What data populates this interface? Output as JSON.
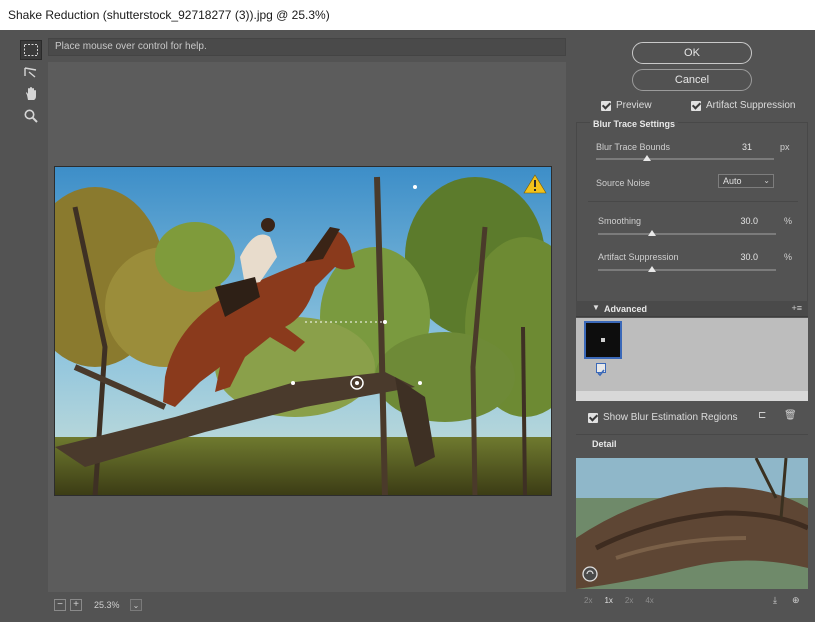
{
  "window": {
    "title": "Shake Reduction (shutterstock_92718277 (3)).jpg @ 25.3%)"
  },
  "tools": [
    {
      "name": "blur-estimation-tool-icon"
    },
    {
      "name": "blur-direction-tool-icon"
    },
    {
      "name": "hand-tool-icon"
    },
    {
      "name": "zoom-tool-icon"
    }
  ],
  "help": {
    "text": "Place mouse over control for help."
  },
  "canvas": {
    "zoom": "25.3%",
    "warning_icon": "warning-icon"
  },
  "buttons": {
    "ok": "OK",
    "cancel": "Cancel"
  },
  "options": {
    "preview": "Preview",
    "artifact_suppression": "Artifact Suppression"
  },
  "blur_trace": {
    "title": "Blur Trace Settings",
    "bounds_label": "Blur Trace Bounds",
    "bounds_value": "31",
    "bounds_unit": "px",
    "noise_label": "Source Noise",
    "noise_value": "Auto",
    "smoothing_label": "Smoothing",
    "smoothing_value": "30.0",
    "smoothing_unit": "%",
    "artifact_label": "Artifact Suppression",
    "artifact_value": "30.0",
    "artifact_unit": "%"
  },
  "advanced": {
    "title": "Advanced",
    "show_regions": "Show Blur Estimation Regions"
  },
  "detail": {
    "title": "Detail",
    "zoom_levels": [
      "2x",
      "1x",
      "2x",
      "4x"
    ],
    "selected_zoom_index": 1
  },
  "colors": {
    "panel_bg": "#535353",
    "accent_border": "#3a68b8",
    "warning": "#f2c21b"
  }
}
